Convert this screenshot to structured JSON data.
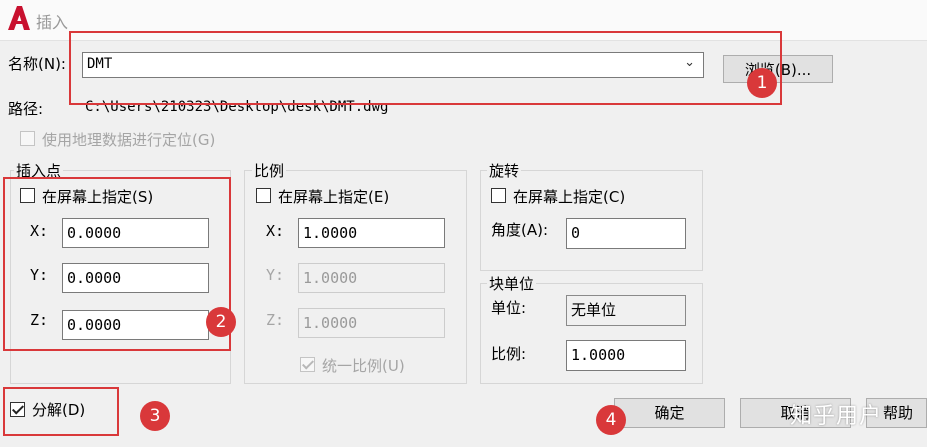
{
  "window": {
    "title": "插入",
    "logo_letter": "A"
  },
  "name_row": {
    "label": "名称(N):",
    "value": "DMT",
    "browse_label": "浏览(B)..."
  },
  "path_row": {
    "label": "路径:",
    "value": "C:\\Users\\210323\\Desktop\\desk\\DMT.dwg"
  },
  "geo_checkbox": {
    "label": "使用地理数据进行定位(G)",
    "checked": false,
    "enabled": false
  },
  "insertion_point": {
    "title": "插入点",
    "specify_label": "在屏幕上指定(S)",
    "specify_checked": false,
    "x_label": "X:",
    "x_value": "0.0000",
    "y_label": "Y:",
    "y_value": "0.0000",
    "z_label": "Z:",
    "z_value": "0.0000"
  },
  "scale": {
    "title": "比例",
    "specify_label": "在屏幕上指定(E)",
    "specify_checked": false,
    "x_label": "X:",
    "x_value": "1.0000",
    "y_label": "Y:",
    "y_value": "1.0000",
    "z_label": "Z:",
    "z_value": "1.0000",
    "uniform_label": "统一比例(U)",
    "uniform_checked": true
  },
  "rotation": {
    "title": "旋转",
    "specify_label": "在屏幕上指定(C)",
    "specify_checked": false,
    "angle_label": "角度(A):",
    "angle_value": "0"
  },
  "block_unit": {
    "title": "块单位",
    "unit_label": "单位:",
    "unit_value": "无单位",
    "factor_label": "比例:",
    "factor_value": "1.0000"
  },
  "explode": {
    "label": "分解(D)",
    "checked": true
  },
  "buttons": {
    "ok": "确定",
    "cancel": "取消",
    "help": "帮助"
  },
  "annotations": [
    "1",
    "2",
    "3",
    "4"
  ],
  "watermark": "知乎用户",
  "colors": {
    "annotation_red": "#d9383a",
    "logo_red": "#c8102e"
  }
}
